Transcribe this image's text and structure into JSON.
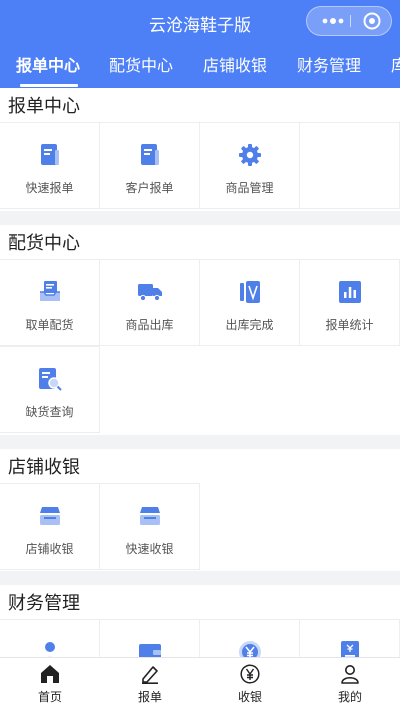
{
  "header": {
    "title": "云沧海鞋子版",
    "bg_color": "#4d7ff7"
  },
  "tabs": [
    {
      "label": "报单中心",
      "active": true
    },
    {
      "label": "配货中心"
    },
    {
      "label": "店铺收银"
    },
    {
      "label": "财务管理"
    },
    {
      "label": "库"
    }
  ],
  "sections": [
    {
      "title": "报单中心",
      "items": [
        {
          "label": "快速报单",
          "icon": "document-icon"
        },
        {
          "label": "客户报单",
          "icon": "document-icon"
        },
        {
          "label": "商品管理",
          "icon": "gear-icon"
        }
      ]
    },
    {
      "title": "配货中心",
      "items": [
        {
          "label": "取单配货",
          "icon": "tray-icon"
        },
        {
          "label": "商品出库",
          "icon": "truck-icon"
        },
        {
          "label": "出库完成",
          "icon": "finish-icon"
        },
        {
          "label": "报单统计",
          "icon": "chart-icon"
        },
        {
          "label": "缺货查询",
          "icon": "search-doc-icon"
        }
      ]
    },
    {
      "title": "店铺收银",
      "items": [
        {
          "label": "店铺收银",
          "icon": "register-icon"
        },
        {
          "label": "快速收银",
          "icon": "register-icon"
        }
      ]
    },
    {
      "title": "财务管理",
      "items": [
        {
          "label": "",
          "icon": "person-icon"
        },
        {
          "label": "",
          "icon": "wallet-icon"
        },
        {
          "label": "",
          "icon": "yuan-circle-icon"
        },
        {
          "label": "",
          "icon": "receipt-icon"
        }
      ]
    }
  ],
  "bottom_nav": [
    {
      "label": "首页",
      "icon": "home-icon",
      "active": true
    },
    {
      "label": "报单",
      "icon": "pen-icon"
    },
    {
      "label": "收银",
      "icon": "yuan-icon"
    },
    {
      "label": "我的",
      "icon": "user-icon"
    }
  ],
  "colors": {
    "accent": "#4d7ff7",
    "icon_blue": "#4f7fe8"
  }
}
